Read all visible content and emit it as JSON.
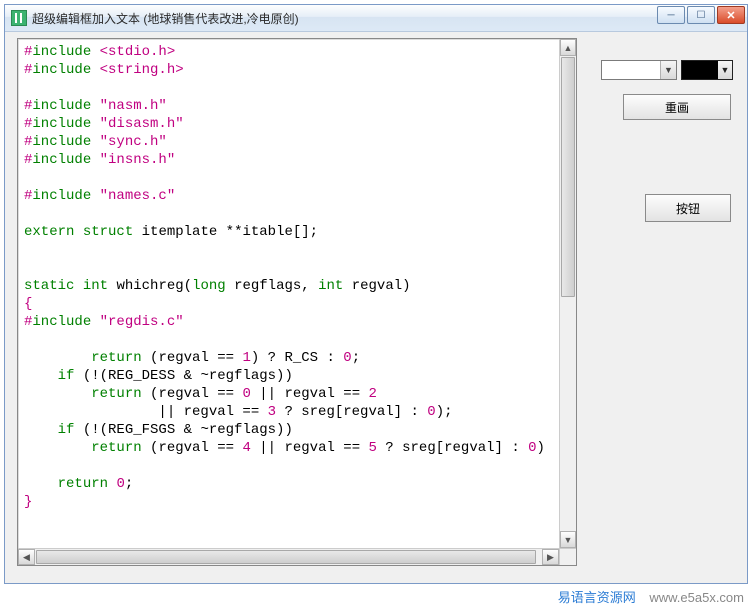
{
  "window": {
    "title": "超级编辑框加入文本 (地球销售代表改进,冷电原创)"
  },
  "controls": {
    "redraw_label": "重画",
    "button_label": "按钮"
  },
  "footer": {
    "brand": "易语言资源网",
    "url": "www.e5a5x.com"
  },
  "code": {
    "lines": [
      [
        [
          "pp",
          "#"
        ],
        [
          "kw",
          "include"
        ],
        [
          "id",
          " "
        ],
        [
          "inc",
          "<stdio.h>"
        ]
      ],
      [
        [
          "pp",
          "#"
        ],
        [
          "kw",
          "include"
        ],
        [
          "id",
          " "
        ],
        [
          "inc",
          "<string.h>"
        ]
      ],
      [],
      [
        [
          "pp",
          "#"
        ],
        [
          "kw",
          "include"
        ],
        [
          "id",
          " "
        ],
        [
          "inc",
          "\"nasm.h\""
        ]
      ],
      [
        [
          "pp",
          "#"
        ],
        [
          "kw",
          "include"
        ],
        [
          "id",
          " "
        ],
        [
          "inc",
          "\"disasm.h\""
        ]
      ],
      [
        [
          "pp",
          "#"
        ],
        [
          "kw",
          "include"
        ],
        [
          "id",
          " "
        ],
        [
          "inc",
          "\"sync.h\""
        ]
      ],
      [
        [
          "pp",
          "#"
        ],
        [
          "kw",
          "include"
        ],
        [
          "id",
          " "
        ],
        [
          "inc",
          "\"insns.h\""
        ]
      ],
      [],
      [
        [
          "pp",
          "#"
        ],
        [
          "kw",
          "include"
        ],
        [
          "id",
          " "
        ],
        [
          "inc",
          "\"names.c\""
        ]
      ],
      [],
      [
        [
          "kw",
          "extern"
        ],
        [
          "id",
          " "
        ],
        [
          "kw",
          "struct"
        ],
        [
          "id",
          " itemplate **itable[];"
        ]
      ],
      [],
      [],
      [
        [
          "kw",
          "static"
        ],
        [
          "id",
          " "
        ],
        [
          "kw",
          "int"
        ],
        [
          "id",
          " whichreg("
        ],
        [
          "kw",
          "long"
        ],
        [
          "id",
          " regflags, "
        ],
        [
          "kw",
          "int"
        ],
        [
          "id",
          " regval)"
        ]
      ],
      [
        [
          "brace",
          "{"
        ]
      ],
      [
        [
          "pp",
          "#"
        ],
        [
          "kw",
          "include"
        ],
        [
          "id",
          " "
        ],
        [
          "inc",
          "\"regdis.c\""
        ]
      ],
      [],
      [
        [
          "id",
          "        "
        ],
        [
          "kw",
          "return"
        ],
        [
          "id",
          " (regval == "
        ],
        [
          "num",
          "1"
        ],
        [
          "id",
          ") ? R_CS : "
        ],
        [
          "num",
          "0"
        ],
        [
          "id",
          ";"
        ]
      ],
      [
        [
          "id",
          "    "
        ],
        [
          "kw",
          "if"
        ],
        [
          "id",
          " (!(REG_DESS & ~regflags))"
        ]
      ],
      [
        [
          "id",
          "        "
        ],
        [
          "kw",
          "return"
        ],
        [
          "id",
          " (regval == "
        ],
        [
          "num",
          "0"
        ],
        [
          "id",
          " || regval == "
        ],
        [
          "num",
          "2"
        ]
      ],
      [
        [
          "id",
          "                || regval == "
        ],
        [
          "num",
          "3"
        ],
        [
          "id",
          " ? sreg[regval] : "
        ],
        [
          "num",
          "0"
        ],
        [
          "id",
          ");"
        ]
      ],
      [
        [
          "id",
          "    "
        ],
        [
          "kw",
          "if"
        ],
        [
          "id",
          " (!(REG_FSGS & ~regflags))"
        ]
      ],
      [
        [
          "id",
          "        "
        ],
        [
          "kw",
          "return"
        ],
        [
          "id",
          " (regval == "
        ],
        [
          "num",
          "4"
        ],
        [
          "id",
          " || regval == "
        ],
        [
          "num",
          "5"
        ],
        [
          "id",
          " ? sreg[regval] : "
        ],
        [
          "num",
          "0"
        ],
        [
          "id",
          ")"
        ]
      ],
      [],
      [
        [
          "id",
          "    "
        ],
        [
          "kw",
          "return"
        ],
        [
          "id",
          " "
        ],
        [
          "num",
          "0"
        ],
        [
          "id",
          ";"
        ]
      ],
      [
        [
          "brace",
          "}"
        ]
      ]
    ]
  }
}
